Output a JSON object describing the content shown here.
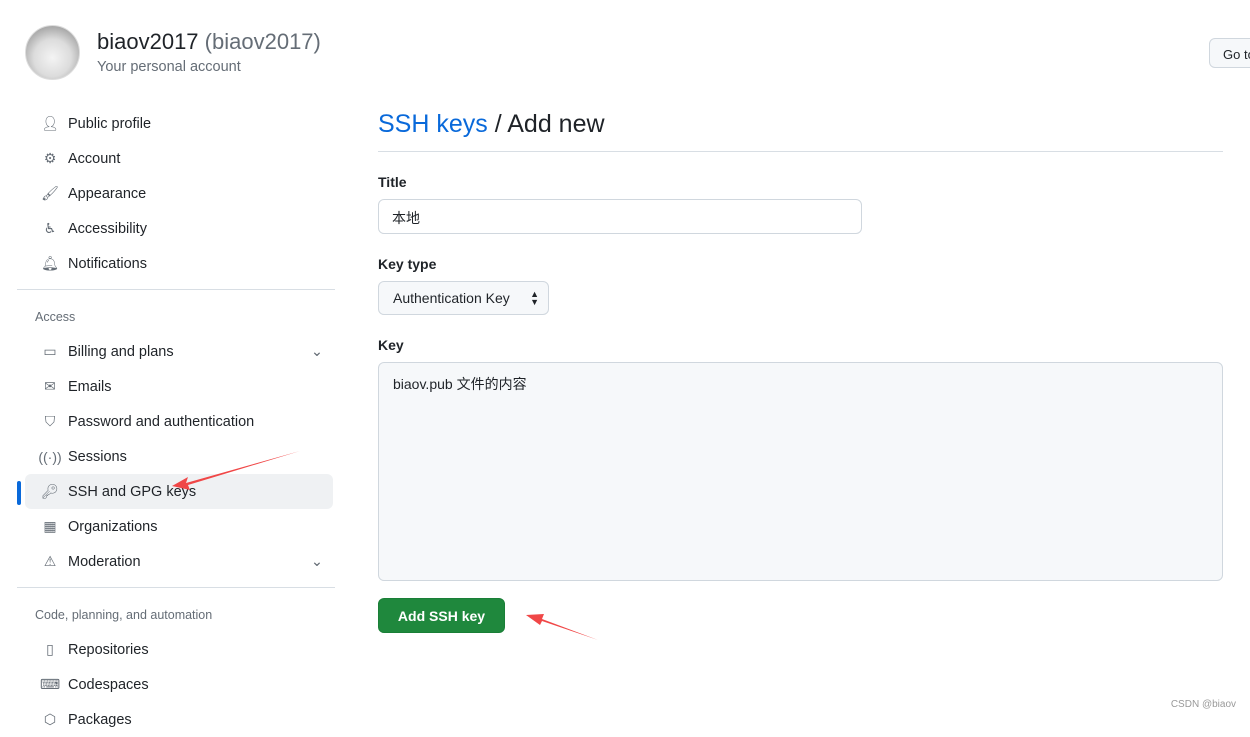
{
  "header": {
    "username": "biaov2017",
    "login": "(biaov2017)",
    "subtitle": "Your personal account",
    "goto_button": "Go to your personal profile"
  },
  "sidebar": {
    "top": [
      {
        "label": "Public profile",
        "icon": "person-icon"
      },
      {
        "label": "Account",
        "icon": "gear-icon"
      },
      {
        "label": "Appearance",
        "icon": "paintbrush-icon"
      },
      {
        "label": "Accessibility",
        "icon": "accessibility-icon"
      },
      {
        "label": "Notifications",
        "icon": "bell-icon"
      }
    ],
    "access_heading": "Access",
    "access": [
      {
        "label": "Billing and plans",
        "icon": "credit-card-icon"
      },
      {
        "label": "Emails",
        "icon": "mail-icon"
      },
      {
        "label": "Password and authentication",
        "icon": "shield-icon"
      },
      {
        "label": "Sessions",
        "icon": "broadcast-icon"
      },
      {
        "label": "SSH and GPG keys",
        "icon": "key-icon",
        "selected": true
      },
      {
        "label": "Organizations",
        "icon": "organization-icon"
      },
      {
        "label": "Moderation",
        "icon": "report-icon"
      }
    ],
    "code_heading": "Code, planning, and automation",
    "code": [
      {
        "label": "Repositories",
        "icon": "repo-icon"
      },
      {
        "label": "Codespaces",
        "icon": "codespaces-icon"
      },
      {
        "label": "Packages",
        "icon": "package-icon"
      }
    ]
  },
  "main": {
    "breadcrumb_link": "SSH keys",
    "breadcrumb_sep": "/",
    "page_title": "Add new",
    "title_label": "Title",
    "title_value": "本地",
    "keytype_label": "Key type",
    "keytype_value": "Authentication Key",
    "key_label": "Key",
    "key_value": "biaov.pub 文件的内容",
    "submit": "Add SSH key"
  },
  "watermark": "CSDN @biaov",
  "colors": {
    "accent": "#0969da",
    "primary_button": "#1f883d",
    "annotation_arrow": "#f04747"
  }
}
